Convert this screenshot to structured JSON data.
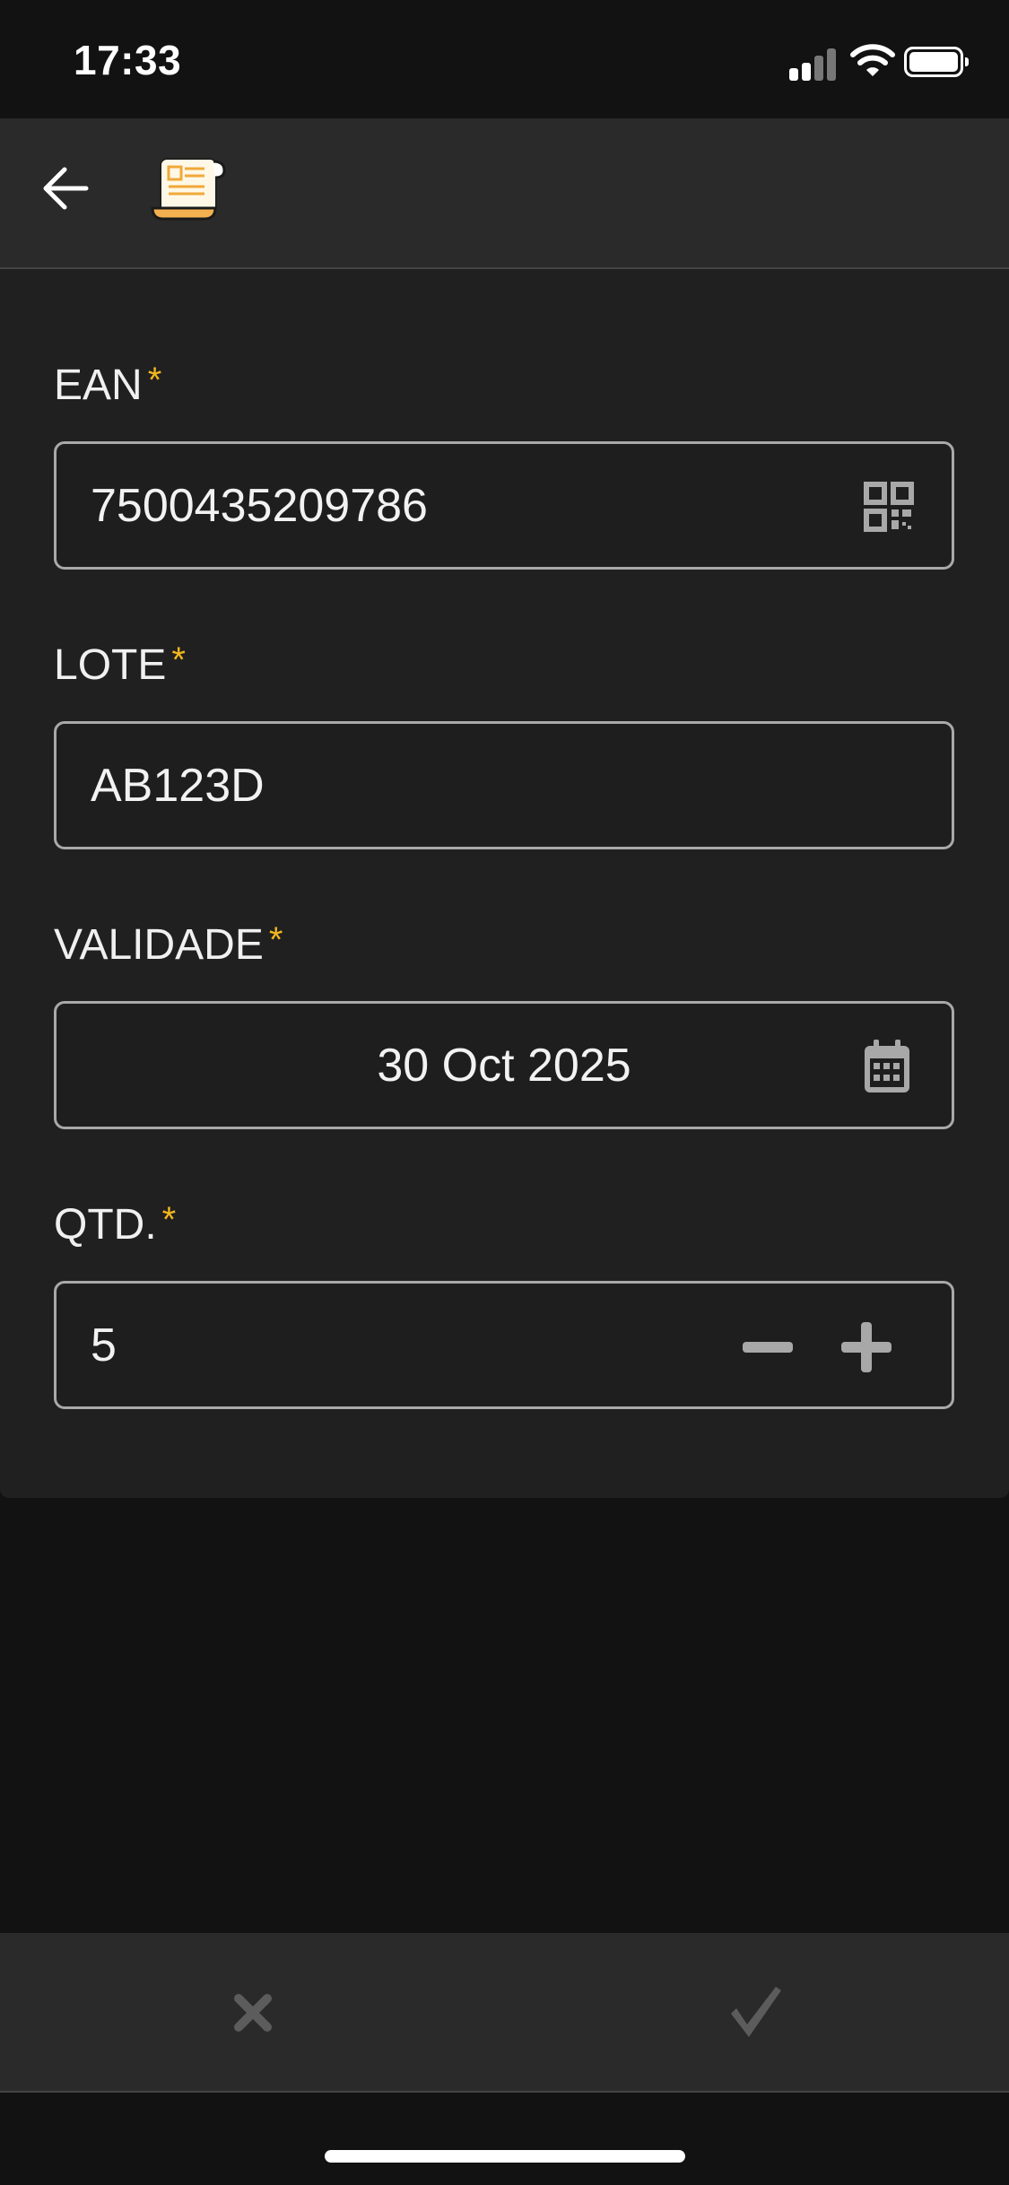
{
  "status_bar": {
    "time": "17:33"
  },
  "app_bar": {
    "back_icon": "arrow-left-icon",
    "logo_icon": "scroll-document-icon"
  },
  "form": {
    "ean": {
      "label": "EAN",
      "required_mark": "*",
      "value": "7500435209786",
      "icon": "qr-code-icon"
    },
    "lote": {
      "label": "LOTE",
      "required_mark": "*",
      "value": "AB123D"
    },
    "validade": {
      "label": "VALIDADE",
      "required_mark": "*",
      "value": "30 Oct 2025",
      "icon": "calendar-icon"
    },
    "qtd": {
      "label": "QTD.",
      "required_mark": "*",
      "value": "5",
      "decrement_icon": "minus-icon",
      "increment_icon": "plus-icon"
    }
  },
  "bottom_bar": {
    "cancel_icon": "close-icon",
    "confirm_icon": "checkmark-icon"
  },
  "colors": {
    "accent_required": "#f2b61f",
    "background": "#121212",
    "card": "#202020",
    "bar": "#2a2a2a"
  }
}
